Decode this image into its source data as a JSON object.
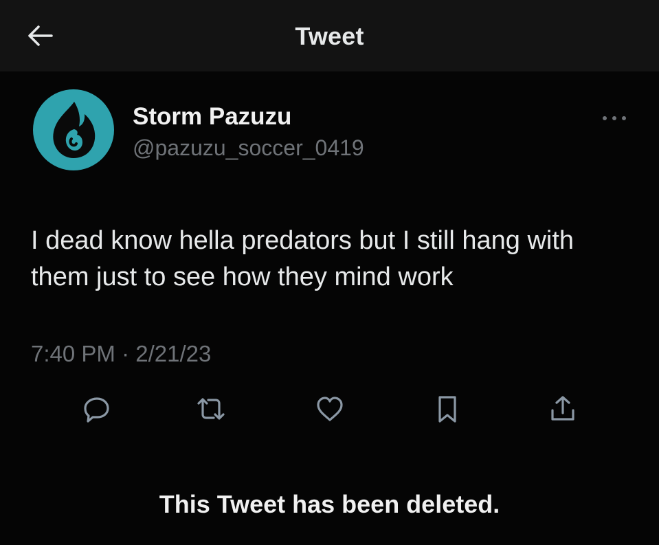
{
  "header": {
    "title": "Tweet",
    "back_icon": "arrow-left-icon"
  },
  "author": {
    "display_name": "Storm Pazuzu",
    "handle": "@pazuzu_soccer_0419",
    "avatar_icon": "flame-icon",
    "avatar_color": "#2fa3ae"
  },
  "tweet": {
    "text": "I dead know hella predators but I still hang with them just to see how they mind work",
    "timestamp": "7:40 PM · 2/21/23"
  },
  "actions": [
    {
      "icon": "reply-icon"
    },
    {
      "icon": "retweet-icon"
    },
    {
      "icon": "like-icon"
    },
    {
      "icon": "bookmark-icon"
    },
    {
      "icon": "share-icon"
    }
  ],
  "more_icon": "more-options-icon",
  "footer": {
    "deleted_notice": "This Tweet has been deleted."
  },
  "colors": {
    "background": "#050505",
    "header_background": "#131313",
    "primary_text": "#e7e9ea",
    "secondary_text": "#6f7378",
    "icon": "#8b98a5"
  }
}
